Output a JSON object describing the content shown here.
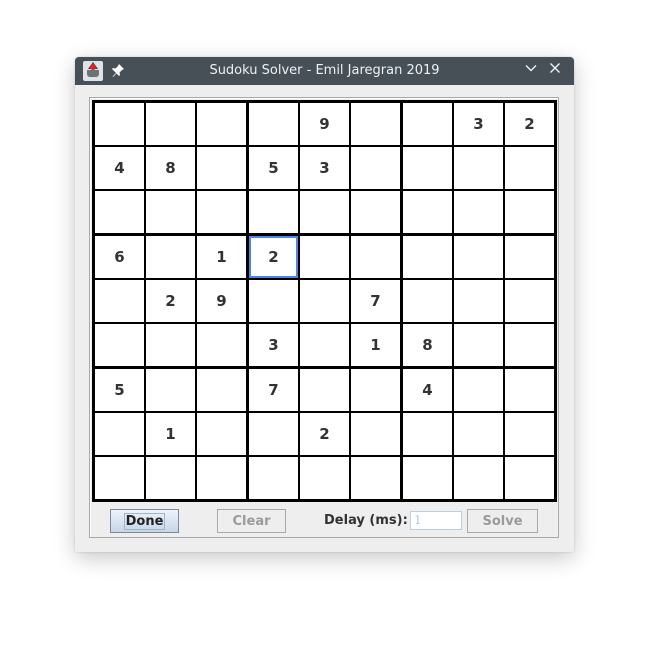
{
  "window": {
    "title": "Sudoku Solver - Emil Jaregran 2019",
    "icons": {
      "app": "java-duke-icon",
      "pin": "pin-icon",
      "minimize": "chevron-down-icon",
      "close": "close-icon"
    },
    "minimize_glyph": "∨",
    "close_glyph": "✕",
    "pin_glyph": "📌"
  },
  "board": {
    "size": 9,
    "selected_cell": {
      "row": 3,
      "col": 3
    },
    "selection_color": "#4a86e8",
    "cells": [
      [
        "",
        "",
        "",
        "",
        "9",
        "",
        "",
        "3",
        "2"
      ],
      [
        "4",
        "8",
        "",
        "5",
        "3",
        "",
        "",
        "",
        ""
      ],
      [
        "",
        "",
        "",
        "",
        "",
        "",
        "",
        "",
        ""
      ],
      [
        "6",
        "",
        "1",
        "2",
        "",
        "",
        "",
        "",
        ""
      ],
      [
        "",
        "2",
        "9",
        "",
        "",
        "7",
        "",
        "",
        ""
      ],
      [
        "",
        "",
        "",
        "3",
        "",
        "1",
        "8",
        "",
        ""
      ],
      [
        "5",
        "",
        "",
        "7",
        "",
        "",
        "4",
        "",
        ""
      ],
      [
        "",
        "1",
        "",
        "",
        "2",
        "",
        "",
        "",
        ""
      ],
      [
        "",
        "",
        "",
        "",
        "",
        "",
        "",
        "",
        ""
      ]
    ]
  },
  "controls": {
    "done_label": "Done",
    "clear_label": "Clear",
    "delay_label": "Delay (ms):",
    "delay_value": "1",
    "solve_label": "Solve"
  }
}
